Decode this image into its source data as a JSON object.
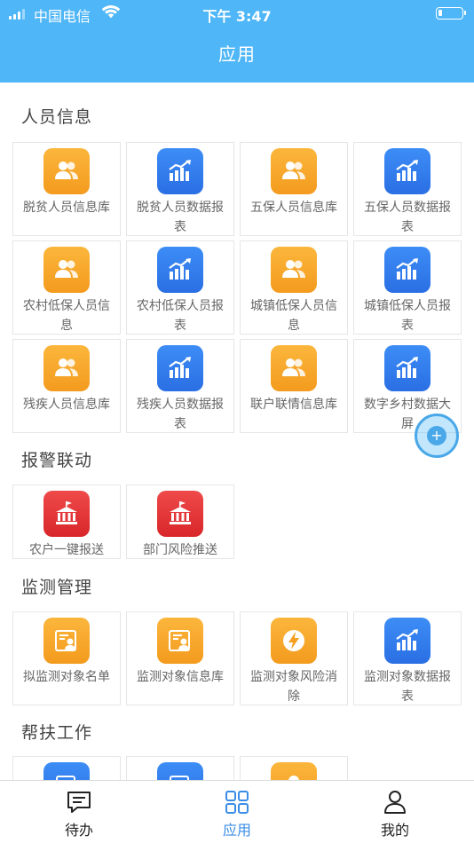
{
  "status_bar": {
    "carrier": "中国电信",
    "time": "下午 3:47"
  },
  "header": {
    "title": "应用"
  },
  "sections": [
    {
      "title": "人员信息",
      "items": [
        {
          "label": "脱贫人员信息库",
          "icon": "people-icon"
        },
        {
          "label": "脱贫人员数据报表",
          "icon": "chart-icon"
        },
        {
          "label": "五保人员信息库",
          "icon": "people-icon"
        },
        {
          "label": "五保人员数据报表",
          "icon": "chart-icon"
        },
        {
          "label": "农村低保人员信息",
          "icon": "people-icon"
        },
        {
          "label": "农村低保人员报表",
          "icon": "chart-icon"
        },
        {
          "label": "城镇低保人员信息",
          "icon": "people-icon"
        },
        {
          "label": "城镇低保人员报表",
          "icon": "chart-icon"
        },
        {
          "label": "残疾人员信息库",
          "icon": "people-icon"
        },
        {
          "label": "残疾人员数据报表",
          "icon": "chart-icon"
        },
        {
          "label": "联户联情信息库",
          "icon": "people-icon"
        },
        {
          "label": "数字乡村数据大屏",
          "icon": "chart-icon"
        }
      ]
    },
    {
      "title": "报警联动",
      "items": [
        {
          "label": "农户一键报送",
          "icon": "bank-icon"
        },
        {
          "label": "部门风险推送",
          "icon": "bank-icon"
        }
      ]
    },
    {
      "title": "监测管理",
      "items": [
        {
          "label": "拟监测对象名单",
          "icon": "id-card-icon"
        },
        {
          "label": "监测对象信息库",
          "icon": "id-card-icon"
        },
        {
          "label": "监测对象风险消除",
          "icon": "lightning-icon"
        },
        {
          "label": "监测对象数据报表",
          "icon": "chart-icon"
        }
      ]
    },
    {
      "title": "帮扶工作",
      "items": [
        {
          "label": "",
          "icon": "edit-icon"
        },
        {
          "label": "",
          "icon": "edit-icon"
        },
        {
          "label": "",
          "icon": "person-icon"
        }
      ]
    }
  ],
  "floating_button": {
    "label": "+"
  },
  "tabbar": {
    "items": [
      {
        "label": "待办",
        "icon": "message-icon"
      },
      {
        "label": "应用",
        "icon": "grid-icon",
        "active": true
      },
      {
        "label": "我的",
        "icon": "user-icon"
      }
    ]
  },
  "colors": {
    "header": "#4fb6f7",
    "accent": "#3a8de6",
    "orange": "#f7a62c",
    "blue": "#2f7cf0",
    "red": "#e53535"
  }
}
